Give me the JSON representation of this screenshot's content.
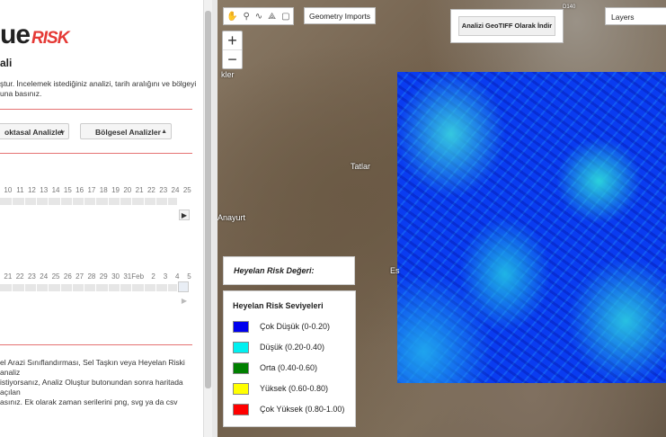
{
  "sidebar": {
    "logo_text": "ue",
    "logo_risk": "RISK",
    "title": "ali",
    "description": "ştur. İncelemek istediğiniz analizi, tarih aralığını ve bölgeyi\nuna basınız.",
    "select_point": "oktasal Analizler",
    "select_region": "Bölgesel Analizler",
    "timeline1": [
      "10",
      "11",
      "12",
      "13",
      "14",
      "15",
      "16",
      "17",
      "18",
      "19",
      "20",
      "21",
      "22",
      "23",
      "24",
      "25"
    ],
    "timeline2": [
      "21",
      "22",
      "23",
      "24",
      "25",
      "26",
      "27",
      "28",
      "29",
      "30",
      "31",
      "Feb",
      "2",
      "3",
      "4",
      "5"
    ],
    "info": "el Arazi Sınıflandırması, Sel Taşkın veya Heyelan Riski analiz\n istiyorsanız, Analiz Oluştur butonundan sonra haritada açılan\nasınız. Ek olarak zaman serilerini png, svg ya da csv"
  },
  "map": {
    "geometry_imports": "Geometry Imports",
    "export_button": "Analizi GeoTIFF Olarak İndir",
    "layers": "Layers",
    "zoom_in": "+",
    "zoom_out": "−",
    "places": {
      "a": "kler",
      "b": "Tatlar",
      "c": "Anayurt",
      "d": "Es",
      "e": "D140"
    },
    "value_box": "Heyelan Risk Değeri:",
    "legend": {
      "title": "Heyelan Risk Seviyeleri",
      "items": [
        {
          "label": "Çok Düşük (0-0.20)",
          "color": "#0000ee"
        },
        {
          "label": "Düşük (0.20-0.40)",
          "color": "#00f0f0"
        },
        {
          "label": "Orta (0.40-0.60)",
          "color": "#008000"
        },
        {
          "label": "Yüksek (0.60-0.80)",
          "color": "#ffff00"
        },
        {
          "label": "Çok Yüksek (0.80-1.00)",
          "color": "#ff0000"
        }
      ]
    }
  }
}
